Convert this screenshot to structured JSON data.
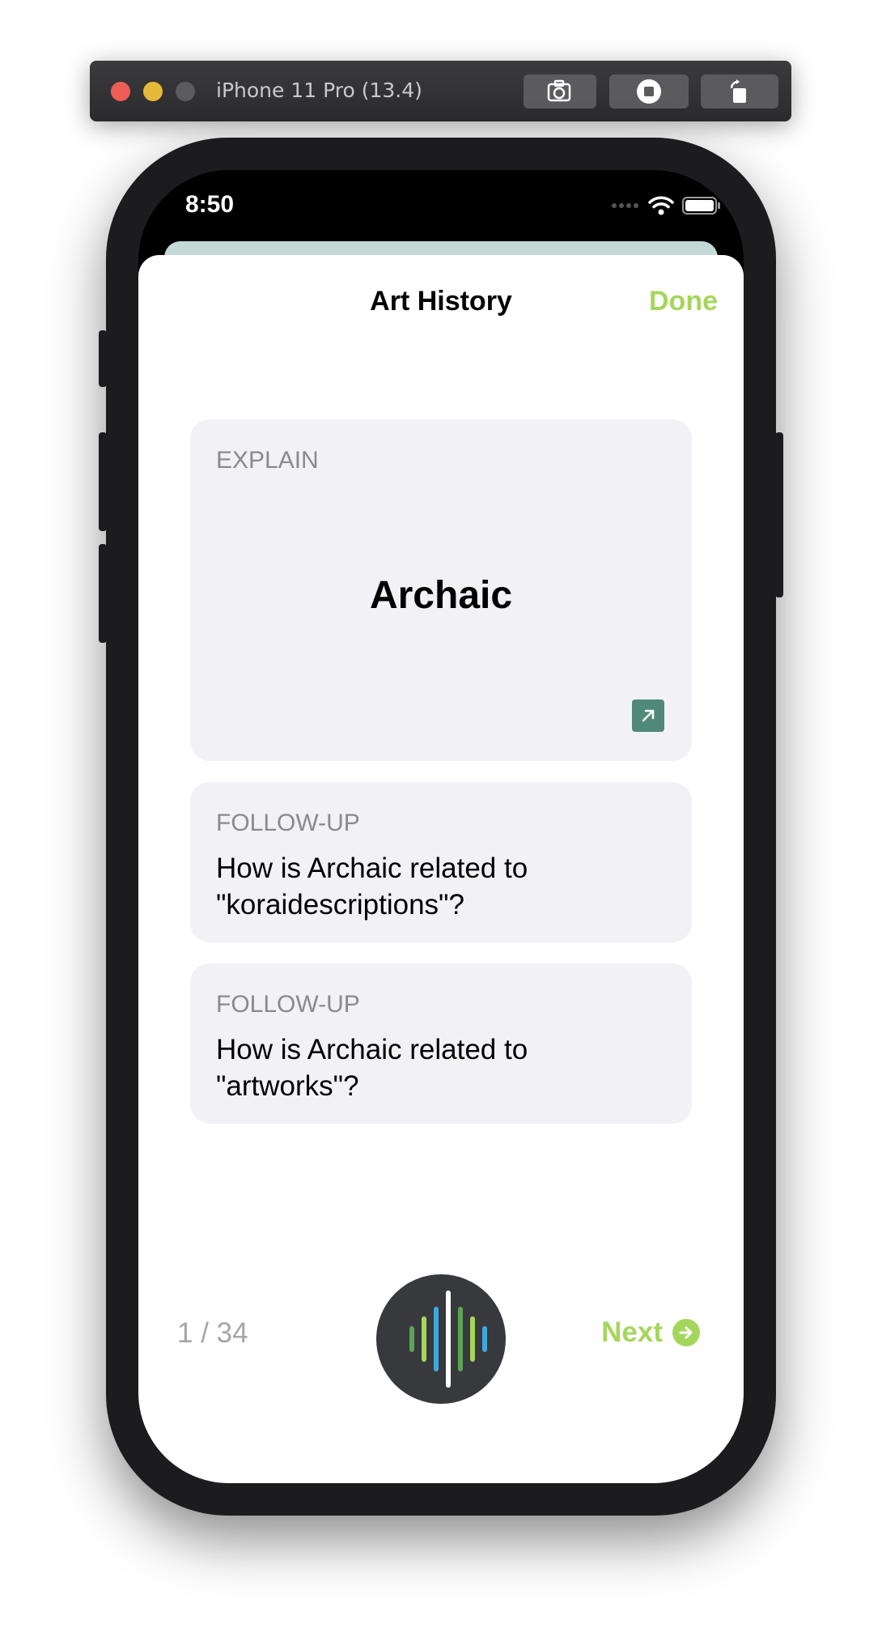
{
  "simulator": {
    "title": "iPhone 11 Pro (13.4)",
    "buttons": [
      "screenshot-icon",
      "home-icon",
      "rotate-icon"
    ]
  },
  "status_bar": {
    "time": "8:50"
  },
  "nav": {
    "title": "Art History",
    "done_label": "Done"
  },
  "explain_card": {
    "label": "EXPLAIN",
    "term": "Archaic",
    "icon": "expand-icon"
  },
  "followups": [
    {
      "label": "FOLLOW-UP",
      "text": "How is Archaic related to \"koraidescriptions\"?"
    },
    {
      "label": "FOLLOW-UP",
      "text": "How is Archaic related to \"artworks\"?"
    }
  ],
  "footer": {
    "counter": "1 / 34",
    "next_label": "Next",
    "mic_icon": "voice-waveform-icon"
  },
  "colors": {
    "accent": "#a5d65c",
    "card_bg": "#f2f2f6",
    "label_gray": "#8a8a8e",
    "expand_icon": "#4e8a77"
  }
}
